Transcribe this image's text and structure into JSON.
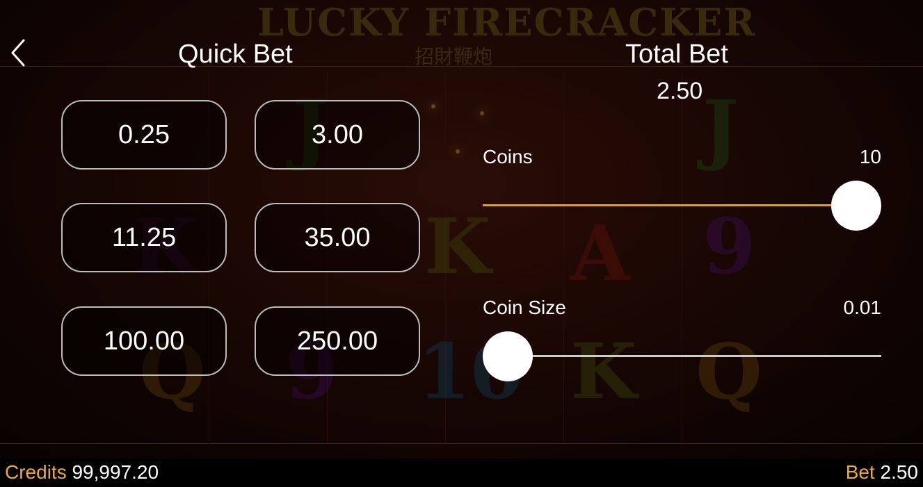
{
  "game": {
    "title_art": "LUCKY FIRECRACKER",
    "subtitle_art": "招財鞭炮"
  },
  "quick_bet": {
    "title": "Quick Bet",
    "options": [
      "0.25",
      "3.00",
      "11.25",
      "35.00",
      "100.00",
      "250.00"
    ]
  },
  "total_bet": {
    "title": "Total Bet",
    "value": "2.50"
  },
  "coins": {
    "label": "Coins",
    "value": "10",
    "level": 1.0
  },
  "coin_size": {
    "label": "Coin Size",
    "value": "0.01",
    "level": 0.0
  },
  "footer": {
    "credits_label": "Credits",
    "credits_value": "99,997.20",
    "bet_label": "Bet",
    "bet_value": "2.50"
  },
  "colors": {
    "accent": "#f0a830",
    "slider_active": "#e0a020",
    "slider_inactive": "#cccccc",
    "button_border": "#bdbdbd"
  },
  "icons": {
    "back": "chevron-left-icon"
  }
}
